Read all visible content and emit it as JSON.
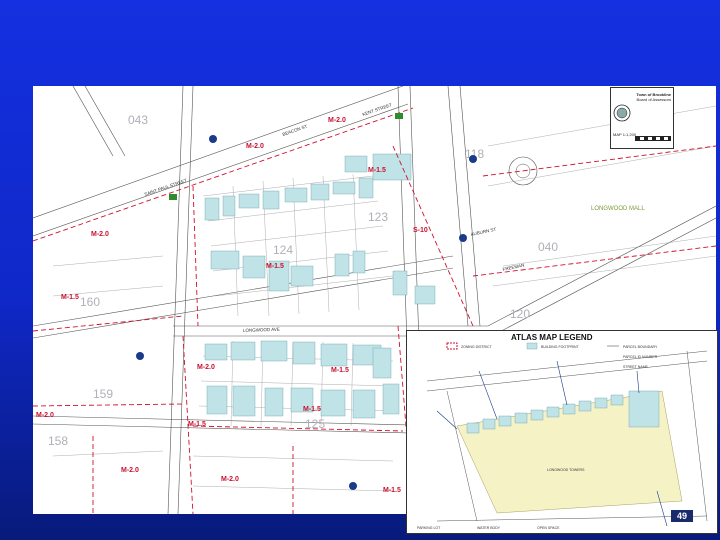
{
  "title_box": {
    "line1": "Town of Brookline",
    "line2": "Board of Assessors",
    "line3": "MAP 1:1,200",
    "seal": "town-seal"
  },
  "blocks": [
    "043",
    "118",
    "123",
    "124",
    "040",
    "120",
    "160",
    "159",
    "158",
    "125"
  ],
  "zones": [
    "M-2.0",
    "M-2.0",
    "M-1.5",
    "M-1.5",
    "M-2.0",
    "S-10",
    "M-1.5",
    "M-2.0",
    "M-1.5",
    "M-1.5",
    "M-2.0",
    "M-1.5",
    "M-2.0",
    "M-2.0",
    "M-1.5"
  ],
  "streets": [
    "BEACON ST",
    "SAINT PAUL STREET",
    "KENT STREET",
    "LONGWOOD AVE",
    "FREEMAN",
    "AUBURN ST"
  ],
  "green_labels": [
    "LONGWOOD MALL"
  ],
  "legend": {
    "title": "ATLAS MAP LEGEND",
    "items": [
      "ZONING DISTRICT",
      "BUILDING FOOTPRINT",
      "PARCEL BOUNDARY",
      "PARCEL ID NUMBER",
      "STREET NAME",
      "PARKING LOT",
      "WATER BODY",
      "OPEN SPACE"
    ],
    "inset_label": "LONGWOOD TOWERS",
    "page_number": "49"
  }
}
